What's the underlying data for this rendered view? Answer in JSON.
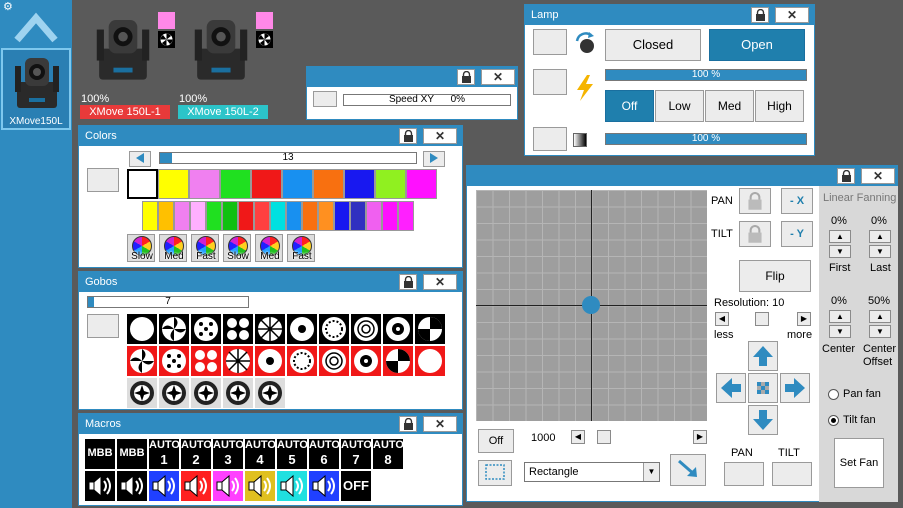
{
  "sidebar": {
    "selected_fixture": "XMove150L"
  },
  "fixtures": [
    {
      "name": "XMove 150L-1",
      "level": "100%",
      "color": "#e83a3a"
    },
    {
      "name": "XMove 150L-2",
      "level": "100%",
      "color": "#2cc4c9"
    }
  ],
  "speed_window": {
    "label": "Speed XY",
    "value": "0%"
  },
  "lamp": {
    "title": "Lamp",
    "closed_label": "Closed",
    "open_label": "Open",
    "strobe_level": "100 %",
    "dimmer_level": "100 %",
    "strobe_fill": 1.0,
    "dimmer_fill": 1.0,
    "modes": [
      "Off",
      "Low",
      "Med",
      "High"
    ],
    "active_mode": "Off"
  },
  "colors": {
    "title": "Colors",
    "slider_value": "13",
    "swatches_top": [
      "#ffffff",
      "#ffff00",
      "#f080f0",
      "#20e020",
      "#f01818",
      "#1890f0",
      "#f87010",
      "#1818f0",
      "#90f020",
      "#ff10ff"
    ],
    "swatches_bottom": [
      "#ffff00",
      "#ffc000",
      "#f080f0",
      "#ffb0ff",
      "#20e020",
      "#10c010",
      "#f01818",
      "#ff4040",
      "#00e0e0",
      "#1890f0",
      "#f87010",
      "#ff9020",
      "#1818f0",
      "#3030c0",
      "#f060f0",
      "#ff10ff",
      "#ff20ff"
    ],
    "speeds": [
      "Slow",
      "Med",
      "Fast",
      "Slow",
      "Med",
      "Fast"
    ]
  },
  "gobos": {
    "title": "Gobos",
    "slider_value": "7"
  },
  "macros": {
    "title": "Macros",
    "buttons": [
      {
        "l1": "MBB",
        "l2": ""
      },
      {
        "l1": "MBB",
        "l2": ""
      },
      {
        "l1": "AUTO",
        "l2": "1"
      },
      {
        "l1": "AUTO",
        "l2": "2"
      },
      {
        "l1": "AUTO",
        "l2": "3"
      },
      {
        "l1": "AUTO",
        "l2": "4"
      },
      {
        "l1": "AUTO",
        "l2": "5"
      },
      {
        "l1": "AUTO",
        "l2": "6"
      },
      {
        "l1": "AUTO",
        "l2": "7"
      },
      {
        "l1": "AUTO",
        "l2": "8"
      }
    ],
    "sound_colors": [
      "#ffffff",
      "#ffffff",
      "#2040ff",
      "#ff2020",
      "#ff40ff",
      "#e0c020",
      "#20e0e0",
      "#2040ff"
    ],
    "off_label": "OFF"
  },
  "pantilt": {
    "pan_label": "PAN",
    "tilt_label": "TILT",
    "invert_x": "- X",
    "invert_y": "- Y",
    "flip": "Flip",
    "resolution_label": "Resolution: 10",
    "less": "less",
    "more": "more",
    "off_button": "Off",
    "speed_value": "1000",
    "shape": "Rectangle",
    "bottom_pan": "PAN",
    "bottom_tilt": "TILT",
    "fanning": {
      "title": "Linear Fanning",
      "first_value": "0%",
      "last_value": "0%",
      "center_value": "0%",
      "offset_value": "50%",
      "first": "First",
      "last": "Last",
      "center": "Center",
      "center_offset": "Center Offset",
      "pan_fan": "Pan fan",
      "tilt_fan": "Tilt fan",
      "set_fan": "Set Fan",
      "selected": "tilt"
    }
  }
}
